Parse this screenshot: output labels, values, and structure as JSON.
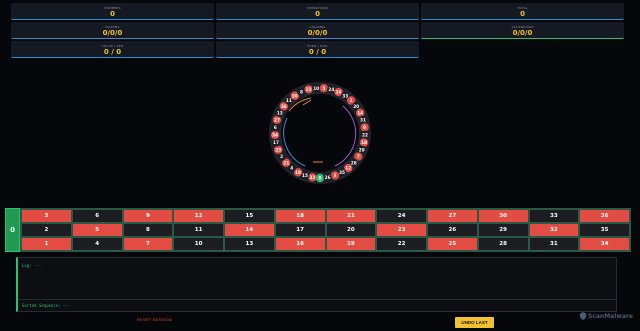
{
  "stats": [
    {
      "id": "numbers",
      "label": "NUMBERS",
      "value": "0"
    },
    {
      "id": "operations",
      "label": "OPERATIONS",
      "value": "0"
    },
    {
      "id": "total",
      "label": "TOTAL",
      "value": "0"
    },
    {
      "id": "dozens",
      "label": "DOZENS",
      "value": "0/0/0"
    },
    {
      "id": "columns",
      "label": "COLUMNS",
      "value": "0/0/0"
    },
    {
      "id": "rows",
      "label": "1ST/2ND/3RD",
      "value": "0/0/0"
    },
    {
      "id": "color",
      "label": "COLOR / RED",
      "value": "0 / 0"
    },
    {
      "id": "parity",
      "label": "EVEN / ODD",
      "value": "0 / 0"
    }
  ],
  "wheel": {
    "sequence": [
      0,
      32,
      15,
      19,
      4,
      21,
      2,
      25,
      17,
      34,
      6,
      27,
      13,
      36,
      11,
      30,
      8,
      23,
      10,
      5,
      24,
      16,
      33,
      1,
      20,
      14,
      31,
      9,
      22,
      18,
      29,
      7,
      28,
      12,
      35,
      3,
      26
    ],
    "red": [
      1,
      3,
      5,
      7,
      9,
      12,
      14,
      16,
      18,
      19,
      21,
      23,
      25,
      27,
      30,
      32,
      34,
      36
    ],
    "colors": {
      "red": "#e34c42",
      "black": "#1b1d22",
      "green": "#2fbf71",
      "blue": "#2f8ed9",
      "purple": "#9b59d0",
      "orange": "#e88a2a"
    }
  },
  "table": {
    "zero": "0",
    "rows": [
      [
        3,
        6,
        9,
        12,
        15,
        18,
        21,
        24,
        27,
        30,
        33,
        36
      ],
      [
        2,
        5,
        8,
        11,
        14,
        17,
        20,
        23,
        26,
        29,
        32,
        35
      ],
      [
        1,
        4,
        7,
        10,
        13,
        16,
        19,
        22,
        25,
        28,
        31,
        34
      ]
    ]
  },
  "log": {
    "label": "Log: ---",
    "sorted": "Sorted Sequence: ---"
  },
  "buttons": {
    "reset": "RESET SESSION",
    "undo": "UNDO LAST"
  },
  "brand": "ScanMalware"
}
